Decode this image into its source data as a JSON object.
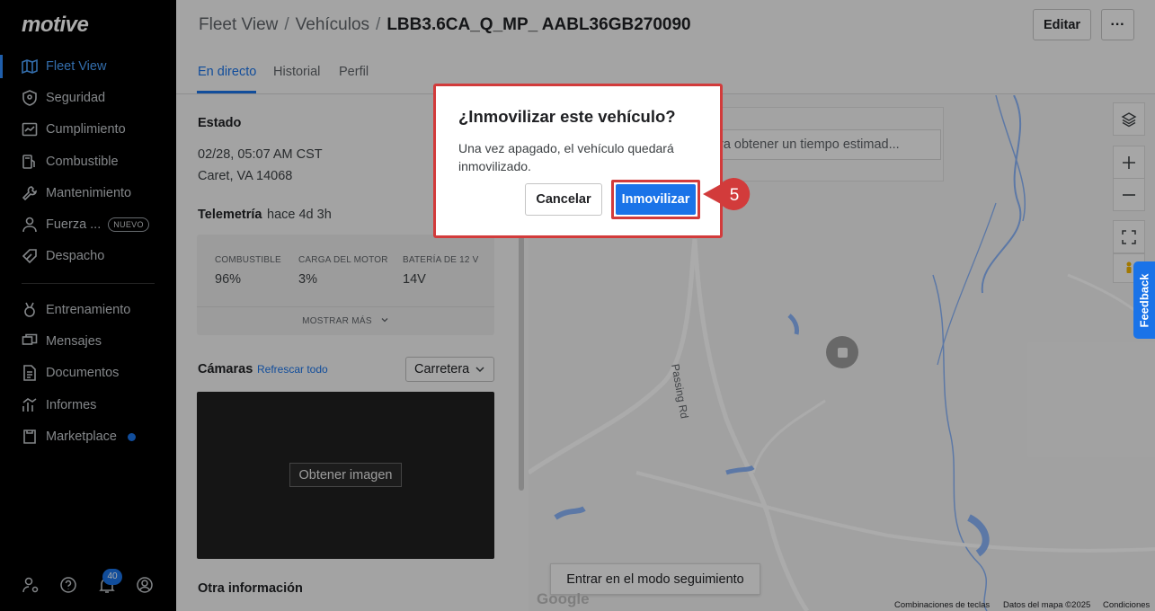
{
  "sidebar": {
    "logo": "motive",
    "items": [
      {
        "label": "Fleet View",
        "icon": "map-icon"
      },
      {
        "label": "Seguridad",
        "icon": "shield-icon"
      },
      {
        "label": "Cumplimiento",
        "icon": "chart-card-icon"
      },
      {
        "label": "Combustible",
        "icon": "fuel-icon"
      },
      {
        "label": "Mantenimiento",
        "icon": "wrench-icon"
      },
      {
        "label": "Fuerza ...",
        "icon": "person-icon",
        "badge": "NUEVO"
      },
      {
        "label": "Despacho",
        "icon": "tag-icon"
      },
      {
        "label": "Entrenamiento",
        "icon": "medal-icon"
      },
      {
        "label": "Mensajes",
        "icon": "messages-icon"
      },
      {
        "label": "Documentos",
        "icon": "document-icon"
      },
      {
        "label": "Informes",
        "icon": "reports-icon"
      },
      {
        "label": "Marketplace",
        "icon": "marketplace-icon"
      }
    ],
    "notification_count": "40"
  },
  "header": {
    "breadcrumb": [
      "Fleet View",
      "Vehículos",
      "LBB3.6CA_Q_MP_ AABL36GB270090"
    ],
    "edit_label": "Editar",
    "more_label": "···",
    "tabs": [
      "En directo",
      "Historial",
      "Perfil"
    ]
  },
  "panel": {
    "status_title": "Estado",
    "status_time": "02/28, 05:07 AM CST",
    "status_location": "Caret, VA 14068",
    "telemetry_title": "Telemetría",
    "telemetry_age": "hace 4d 3h",
    "telemetry": [
      {
        "label": "COMBUSTIBLE",
        "value": "96%"
      },
      {
        "label": "CARGA DEL MOTOR",
        "value": "3%"
      },
      {
        "label": "BATERÍA DE 12 V",
        "value": "14V"
      }
    ],
    "show_more": "MOSTRAR MÁS",
    "cameras_title": "Cámaras",
    "refresh_all": "Refrescar todo",
    "camera_select": "Carretera",
    "get_image": "Obtener imagen",
    "other_info": "Otra información"
  },
  "map": {
    "eta_placeholder": "ra obtener un tiempo estimad...",
    "road_name": "Passing Rd",
    "follow_mode": "Entrar en el modo seguimiento",
    "google": "Google",
    "footer": [
      "Combinaciones de teclas",
      "Datos del mapa ©2025",
      "Condiciones"
    ],
    "feedback": "Feedback"
  },
  "dialog": {
    "title": "¿Inmovilizar este vehículo?",
    "body": "Una vez apagado, el vehículo quedará inmovilizado.",
    "cancel": "Cancelar",
    "confirm": "Inmovilizar"
  },
  "step_number": "5",
  "colors": {
    "accent": "#1a73e8",
    "highlight": "#d23b3b"
  }
}
